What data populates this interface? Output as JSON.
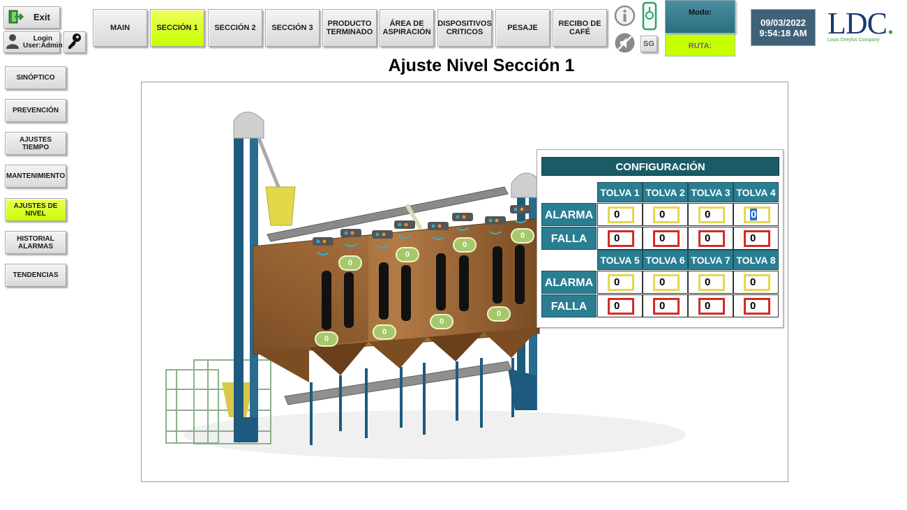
{
  "header": {
    "exit_label": "Exit",
    "login_line1": "Login",
    "login_line2": "User:Admin",
    "nav": [
      {
        "label": "MAIN",
        "active": false
      },
      {
        "label": "SECCIÓN 1",
        "active": true
      },
      {
        "label": "SECCIÓN 2",
        "active": false
      },
      {
        "label": "SECCIÓN 3",
        "active": false
      },
      {
        "label": "PRODUCTO TERMINADO",
        "active": false
      },
      {
        "label": "ÁREA DE ASPIRACIÓN",
        "active": false
      },
      {
        "label": "DISPOSITIVOS CRITICOS",
        "active": false
      },
      {
        "label": "PESAJE",
        "active": false
      },
      {
        "label": "RECIBO DE CAFÉ",
        "active": false
      }
    ],
    "sg_label": "SG",
    "mode_label": "Modo:",
    "route_label": "RUTA:",
    "date": "09/03/2022",
    "time": "9:54:18 AM",
    "logo_text": "LDC",
    "logo_subtext": "Louis Dreyfus Company"
  },
  "sidebar": [
    {
      "label": "SINÓPTICO",
      "active": false
    },
    {
      "label": "PREVENCIÓN",
      "active": false
    },
    {
      "label": "AJUSTES TIEMPO",
      "active": false
    },
    {
      "label": "MANTENIMIENTO",
      "active": false
    },
    {
      "label": "AJUSTES DE NIVEL",
      "active": true
    },
    {
      "label": "HISTORIAL ALARMAS",
      "active": false
    },
    {
      "label": "TENDENCIAS",
      "active": false
    }
  ],
  "page_title": "Ajuste Nivel Sección 1",
  "config": {
    "title": "CONFIGURACIÓN",
    "groups": [
      {
        "headers": [
          "TOLVA 1",
          "TOLVA 2",
          "TOLVA 3",
          "TOLVA 4"
        ],
        "alarma_label": "ALARMA",
        "falla_label": "FALLA",
        "alarma": [
          "0",
          "0",
          "0",
          "0"
        ],
        "falla": [
          "0",
          "0",
          "0",
          "0"
        ]
      },
      {
        "headers": [
          "TOLVA 5",
          "TOLVA 6",
          "TOLVA 7",
          "TOLVA 8"
        ],
        "alarma_label": "ALARMA",
        "falla_label": "FALLA",
        "alarma": [
          "0",
          "0",
          "0",
          "0"
        ],
        "falla": [
          "0",
          "0",
          "0",
          "0"
        ]
      }
    ]
  },
  "level_tags": [
    "0",
    "0",
    "0",
    "0",
    "0",
    "0",
    "0",
    "0"
  ],
  "colors": {
    "active_button": "#c8ff00",
    "table_header": "#2a7e92",
    "config_title": "#1a5b66",
    "alarm_border": "#e4d84e",
    "fault_border": "#d42a2a",
    "level_tag": "#a6c86a"
  },
  "icons": {
    "exit": "exit-icon",
    "user": "user-icon",
    "key": "key-icon",
    "info": "info-icon",
    "phone": "phone-icon",
    "sound_off": "sound-off-icon"
  }
}
